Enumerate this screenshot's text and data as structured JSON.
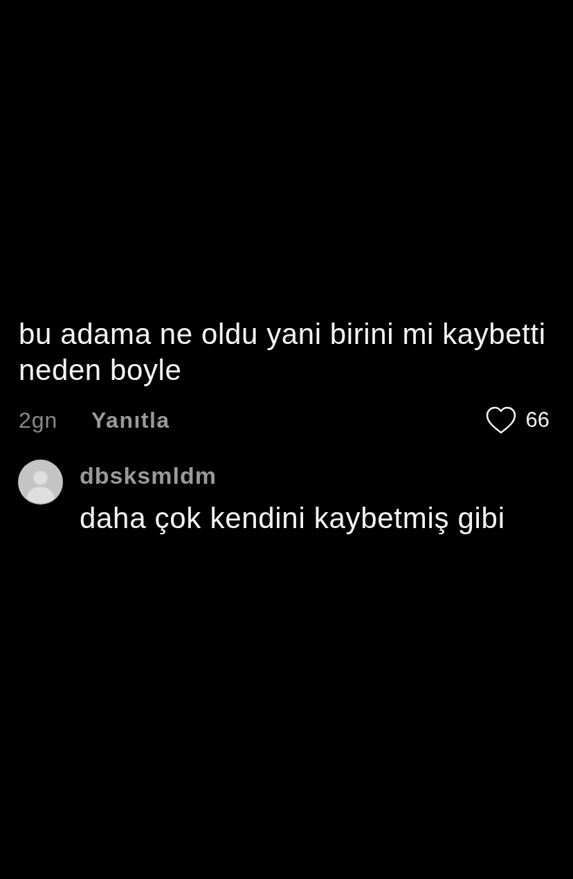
{
  "comment": {
    "text": "bu adama ne oldu yani birini mi kaybetti neden boyle",
    "time": "2gn",
    "reply_label": "Yanıtla",
    "liked": false,
    "likes": "66"
  },
  "replies": [
    {
      "username": "dbsksmldm",
      "text": "daha çok kendini kaybetmiş gibi"
    }
  ]
}
